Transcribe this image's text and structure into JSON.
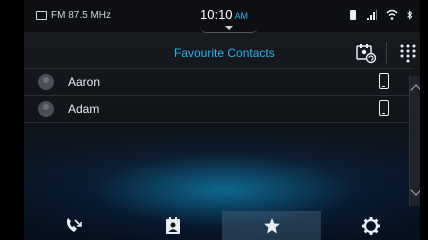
{
  "status_bar": {
    "radio_text": "FM 87.5 MHz",
    "time": "10:10",
    "ampm": "AM",
    "icons": [
      "phone-battery-icon",
      "signal-icon",
      "wifi-icon",
      "bluetooth-icon"
    ]
  },
  "header": {
    "title": "Favourite Contacts",
    "sync_icon": "contacts-sync-icon",
    "keypad_icon": "keypad-icon"
  },
  "contacts": [
    {
      "name": "Aaron",
      "icon": "mobile-phone-icon"
    },
    {
      "name": "Adam",
      "icon": "mobile-phone-icon"
    }
  ],
  "bottom_nav": [
    {
      "id": "recent-calls",
      "icon": "call-log-icon",
      "active": false
    },
    {
      "id": "contacts",
      "icon": "contacts-book-icon",
      "active": false
    },
    {
      "id": "favourites",
      "icon": "star-icon",
      "active": true
    },
    {
      "id": "settings",
      "icon": "gear-icon",
      "active": false
    }
  ],
  "colors": {
    "accent": "#27b3ee",
    "text": "#e8eef5",
    "background": "#15181d"
  }
}
